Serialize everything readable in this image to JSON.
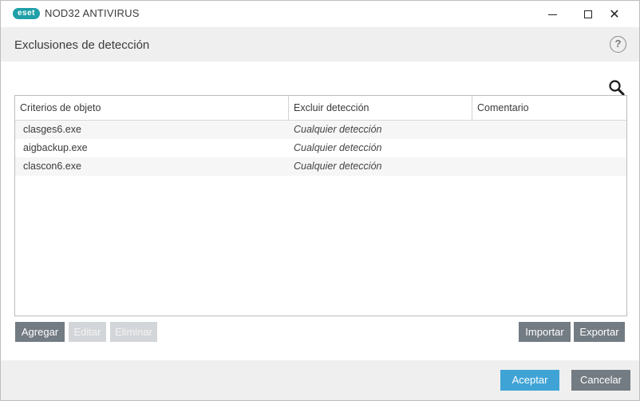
{
  "window": {
    "logo_text": "eset",
    "product_name": "NOD32 ANTIVIRUS",
    "minimize_icon": "minimize-icon",
    "maximize_icon": "maximize-icon",
    "close_icon": "close-icon",
    "close_glyph": "✕"
  },
  "header": {
    "title": "Exclusiones de detección",
    "help_glyph": "?"
  },
  "table": {
    "columns": [
      "Criterios de objeto",
      "Excluir detección",
      "Comentario"
    ],
    "rows": [
      {
        "object": "clasges6.exe",
        "detection": "Cualquier detección",
        "comment": ""
      },
      {
        "object": "aigbackup.exe",
        "detection": "Cualquier detección",
        "comment": ""
      },
      {
        "object": "clascon6.exe",
        "detection": "Cualquier detección",
        "comment": ""
      }
    ]
  },
  "toolbar": {
    "add_label": "Agregar",
    "edit_label": "Editar",
    "delete_label": "Eliminar",
    "import_label": "Importar",
    "export_label": "Exportar"
  },
  "footer": {
    "ok_label": "Aceptar",
    "cancel_label": "Cancelar"
  },
  "colors": {
    "brand": "#1f9fa8",
    "primary_button": "#3fa3d6",
    "secondary_button": "#737b83",
    "disabled_button": "#d3d6d9"
  }
}
